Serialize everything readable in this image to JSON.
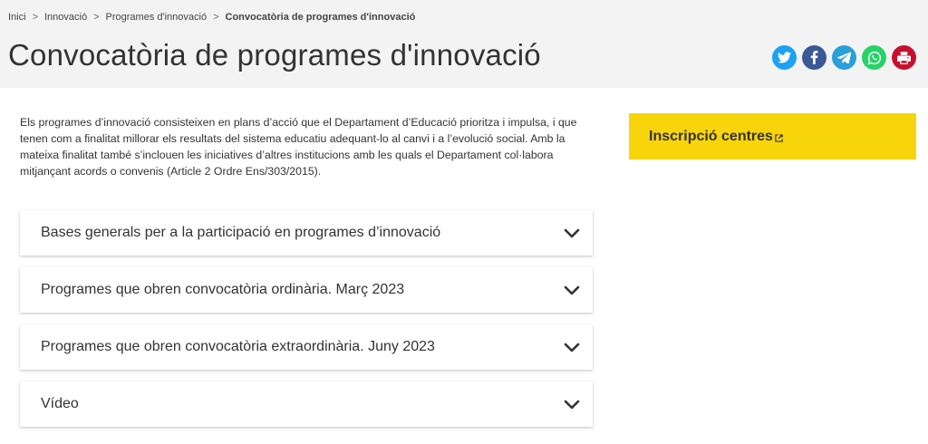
{
  "breadcrumb": {
    "items": [
      "Inici",
      "Innovació",
      "Programes d'innovació"
    ],
    "current": "Convocatòria de programes d'innovació",
    "separator": ">"
  },
  "page_title": "Convocatòria de programes d'innovació",
  "share": {
    "icons": [
      {
        "name": "twitter-icon",
        "color": "#1da1f2"
      },
      {
        "name": "facebook-icon",
        "color": "#3b5998"
      },
      {
        "name": "telegram-icon",
        "color": "#2aa0d8"
      },
      {
        "name": "whatsapp-icon",
        "color": "#25d366"
      },
      {
        "name": "print-icon",
        "color": "#c8102e"
      }
    ]
  },
  "intro_text": "Els programes d’innovació consisteixen en plans d’acció que el Departament d’Educació prioritza i impulsa, i que tenen com a finalitat millorar els resultats del sistema educatiu adequant-lo al canvi i a l’evolució social. Amb la mateixa finalitat també s’inclouen les iniciatives d’altres institucions amb les quals el Departament col·labora mitjançant acords o convenis (Article 2 Ordre Ens/303/2015).",
  "accordion": [
    {
      "label": "Bases generals per a la participació en programes d’innovació"
    },
    {
      "label": "Programes que obren convocatòria ordinària. Març 2023"
    },
    {
      "label": "Programes que obren convocatòria extraordinària. Juny 2023"
    },
    {
      "label": "Vídeo"
    }
  ],
  "sidebar": {
    "cta_label": "Inscripció centres",
    "cta_color": "#f8d40b"
  }
}
